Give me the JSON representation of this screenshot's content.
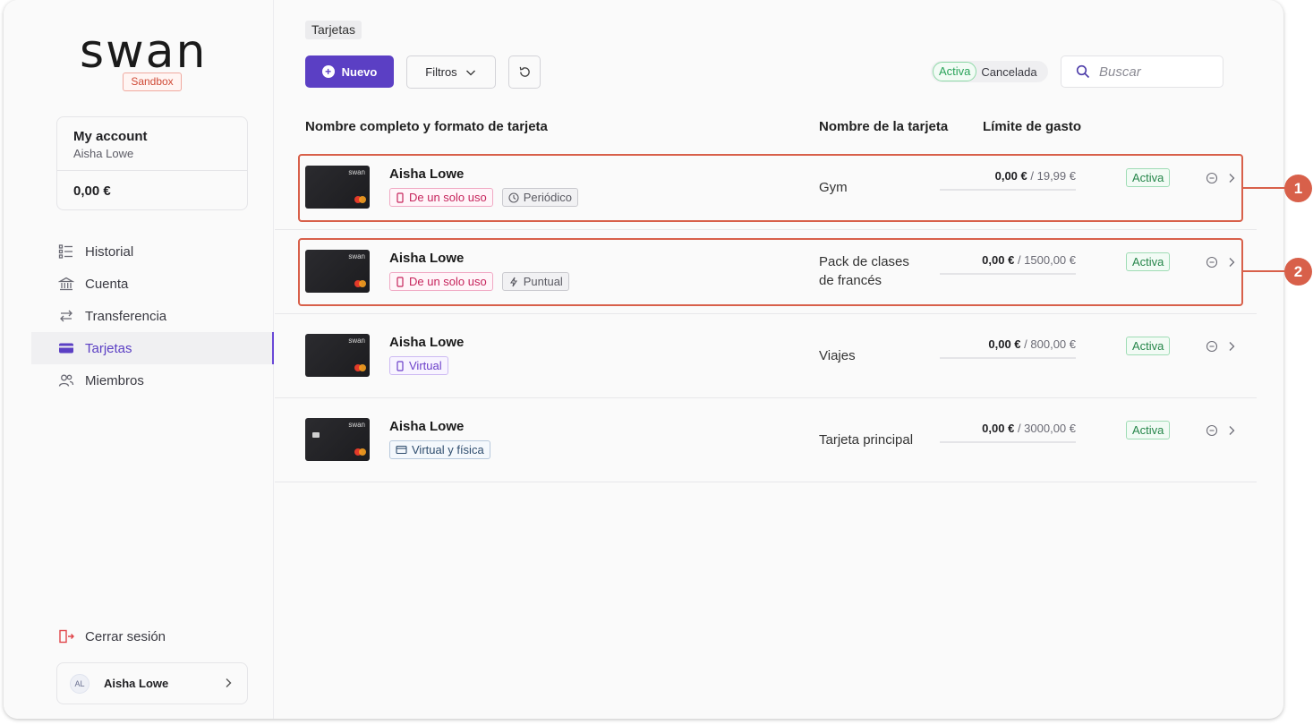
{
  "brand": {
    "logo": "swan",
    "env_badge": "Sandbox"
  },
  "account": {
    "title": "My account",
    "subtitle": "Aisha Lowe",
    "balance": "0,00 €"
  },
  "nav": {
    "items": [
      {
        "label": "Historial",
        "icon": "list-icon"
      },
      {
        "label": "Cuenta",
        "icon": "bank-icon"
      },
      {
        "label": "Transferencia",
        "icon": "transfer-icon"
      },
      {
        "label": "Tarjetas",
        "icon": "card-icon",
        "active": true
      },
      {
        "label": "Miembros",
        "icon": "members-icon"
      }
    ]
  },
  "logout_label": "Cerrar sesión",
  "user": {
    "initials": "AL",
    "name": "Aisha Lowe"
  },
  "page": {
    "breadcrumb": "Tarjetas"
  },
  "toolbar": {
    "new_label": "Nuevo",
    "filters_label": "Filtros",
    "status_toggle": {
      "active": "Activa",
      "cancelled": "Cancelada"
    },
    "search_placeholder": "Buscar"
  },
  "table": {
    "columns": {
      "name": "Nombre completo y formato de tarjeta",
      "card_name": "Nombre de la tarjeta",
      "limit": "Límite de gasto"
    },
    "rows": [
      {
        "holder": "Aisha Lowe",
        "card_brand": "swan",
        "tags": [
          {
            "label": "De un solo uso",
            "style": "pink"
          },
          {
            "label": "Periódico",
            "style": "grey"
          }
        ],
        "card_name": "Gym",
        "spent": "0,00 €",
        "limit": "/ 19,99 €",
        "status": "Activa"
      },
      {
        "holder": "Aisha Lowe",
        "card_brand": "swan",
        "tags": [
          {
            "label": "De un solo uso",
            "style": "pink"
          },
          {
            "label": "Puntual",
            "style": "grey"
          }
        ],
        "card_name": "Pack de clases de francés",
        "spent": "0,00 €",
        "limit": "/ 1500,00 €",
        "status": "Activa"
      },
      {
        "holder": "Aisha Lowe",
        "card_brand": "swan",
        "tags": [
          {
            "label": "Virtual",
            "style": "purple"
          }
        ],
        "card_name": "Viajes",
        "spent": "0,00 €",
        "limit": "/ 800,00 €",
        "status": "Activa"
      },
      {
        "holder": "Aisha Lowe",
        "card_brand": "swan",
        "tags": [
          {
            "label": "Virtual y física",
            "style": "blue"
          }
        ],
        "card_name": "Tarjeta principal",
        "spent": "0,00 €",
        "limit": "/ 3000,00 €",
        "status": "Activa"
      }
    ]
  },
  "callouts": [
    "1",
    "2"
  ],
  "colors": {
    "accent": "#5b3fc4",
    "callout": "#d8604a",
    "status_green": "#26864a"
  }
}
